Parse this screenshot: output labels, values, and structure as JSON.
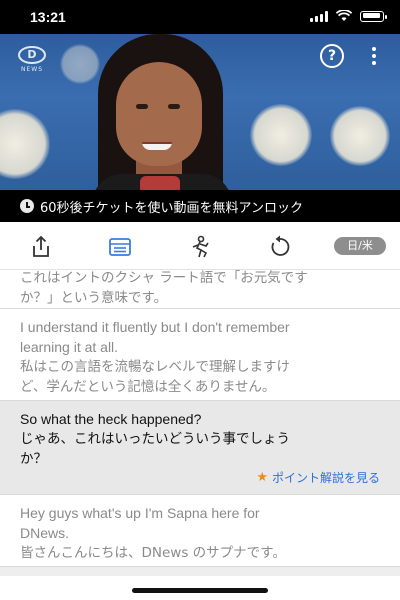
{
  "status": {
    "time": "13:21"
  },
  "video": {
    "logo_mark": "D",
    "logo_text": "NEWS",
    "help_label": "?"
  },
  "promo": {
    "text": "60秒後チケットを使い動画を無料アンロック"
  },
  "toolbar": {
    "icons": [
      "share-icon",
      "script-icon",
      "shadowing-icon",
      "replay-icon"
    ],
    "language_toggle": "日/米",
    "accent_color": "#3b7be0"
  },
  "transcript": [
    {
      "en": "",
      "ja_line1": "これはイントのクシャ ラート語で「お元気です",
      "ja_line2": "か？」という意味です。"
    },
    {
      "en_line1": "I understand it fluently but I don't remember",
      "en_line2": "learning it at all.",
      "ja_line1": "私はこの言語を流暢なレベルで理解しますけ",
      "ja_line2": "ど、学んだという記憶は全くありません。"
    },
    {
      "en_line1": "So what the heck happened?",
      "ja_line1": "じゃあ、これはいったいどういう事でしょう",
      "ja_line2": "か？",
      "point_link": "ポイント解説を見る",
      "active": true
    },
    {
      "en_line1": "Hey guys what's up I'm Sapna here for",
      "en_line2": "DNews.",
      "ja_line1": "皆さんこんにちは、DNews のサプナです。"
    }
  ],
  "colors": {
    "link": "#2b6fd6",
    "star": "#f08a1c",
    "active_row": "#e8e8e8"
  }
}
